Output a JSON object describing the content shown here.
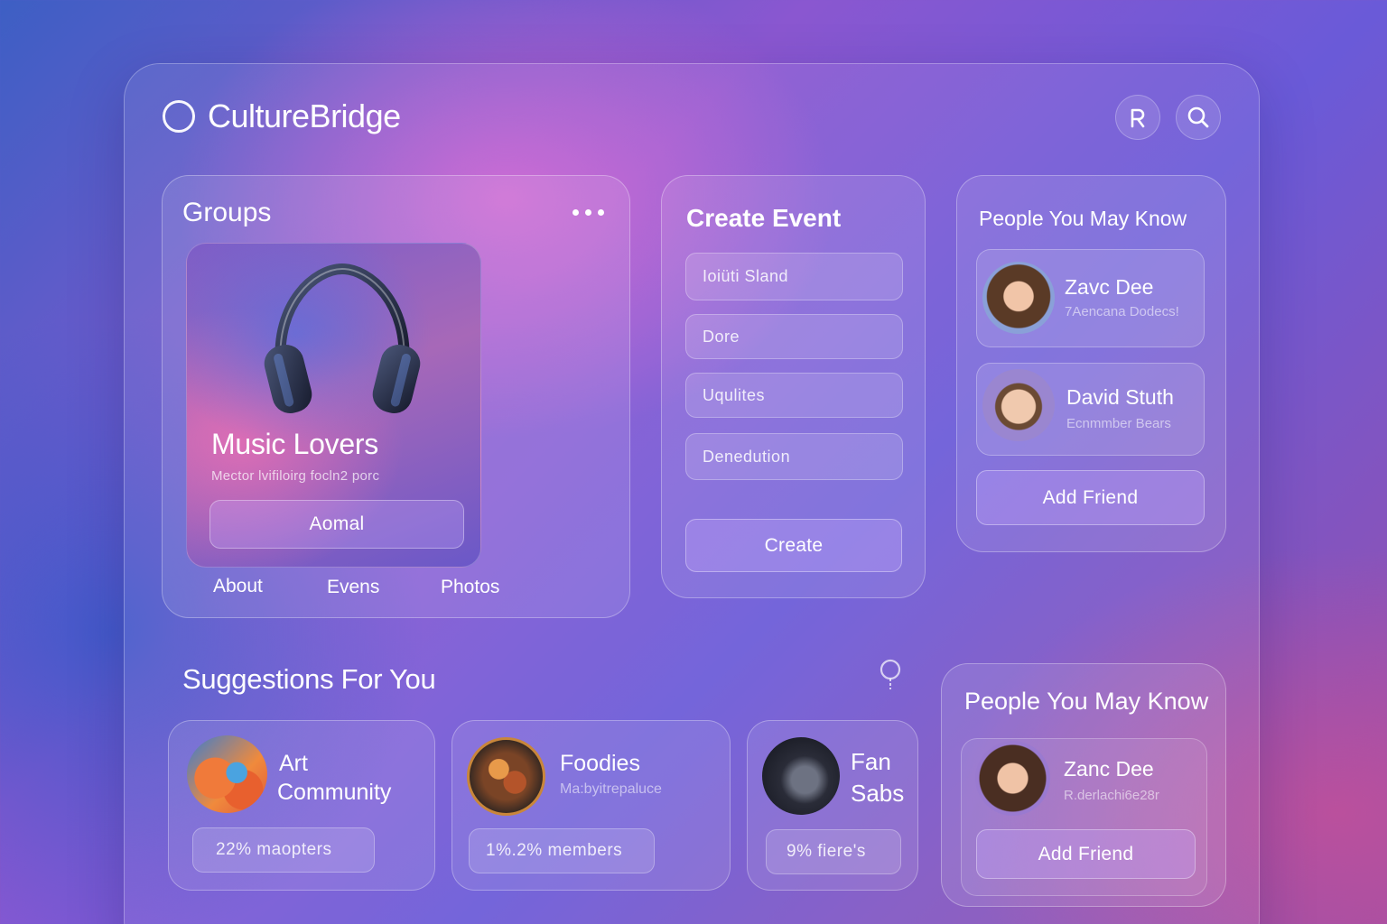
{
  "app": {
    "title": "CultureBridge"
  },
  "header": {
    "profile_icon": "profile-icon",
    "search_icon": "search-icon"
  },
  "groups": {
    "title": "Groups",
    "more_icon": "more-icon",
    "featured": {
      "name": "Music Lovers",
      "subtitle": "Mector lvifiloirg focln2 porc",
      "button_label": "Aomal",
      "image_icon": "headphones-icon"
    },
    "tabs": [
      "About",
      "Evens",
      "Photos"
    ]
  },
  "create_event": {
    "title": "Create Event",
    "fields": [
      "Ioiüti Sland",
      "Dore",
      "Uqulites",
      "Denedution"
    ],
    "button_label": "Create"
  },
  "people_top": {
    "title": "People You May Know",
    "people": [
      {
        "name": "Zavc Dee",
        "subtitle": "7Aencana Dodecs!"
      },
      {
        "name": "David Stuth",
        "subtitle": "Ecnmmber Bears"
      }
    ],
    "button_label": "Add Friend"
  },
  "suggestions": {
    "title": "Suggestions For You",
    "pin_icon": "location-pin-icon",
    "items": [
      {
        "name_line1": "Art",
        "name_line2": "Community",
        "meta": "",
        "badge": "22% maopters"
      },
      {
        "name_line1": "Foodies",
        "name_line2": "",
        "meta": "Ma:byitrepaluce",
        "badge": "1%.2% members"
      },
      {
        "name_line1": "Fan",
        "name_line2": "Sabs",
        "meta": "",
        "badge": "9% fiere's"
      }
    ]
  },
  "people_bottom": {
    "title": "People You May Know",
    "people": [
      {
        "name": "Zanc Dee",
        "subtitle": "R.derlachi6e28r"
      }
    ],
    "button_label": "Add Friend"
  },
  "colors": {
    "accent": "#b9a2ff",
    "background_start": "#3d5fc4",
    "background_end": "#9a4fa8"
  }
}
